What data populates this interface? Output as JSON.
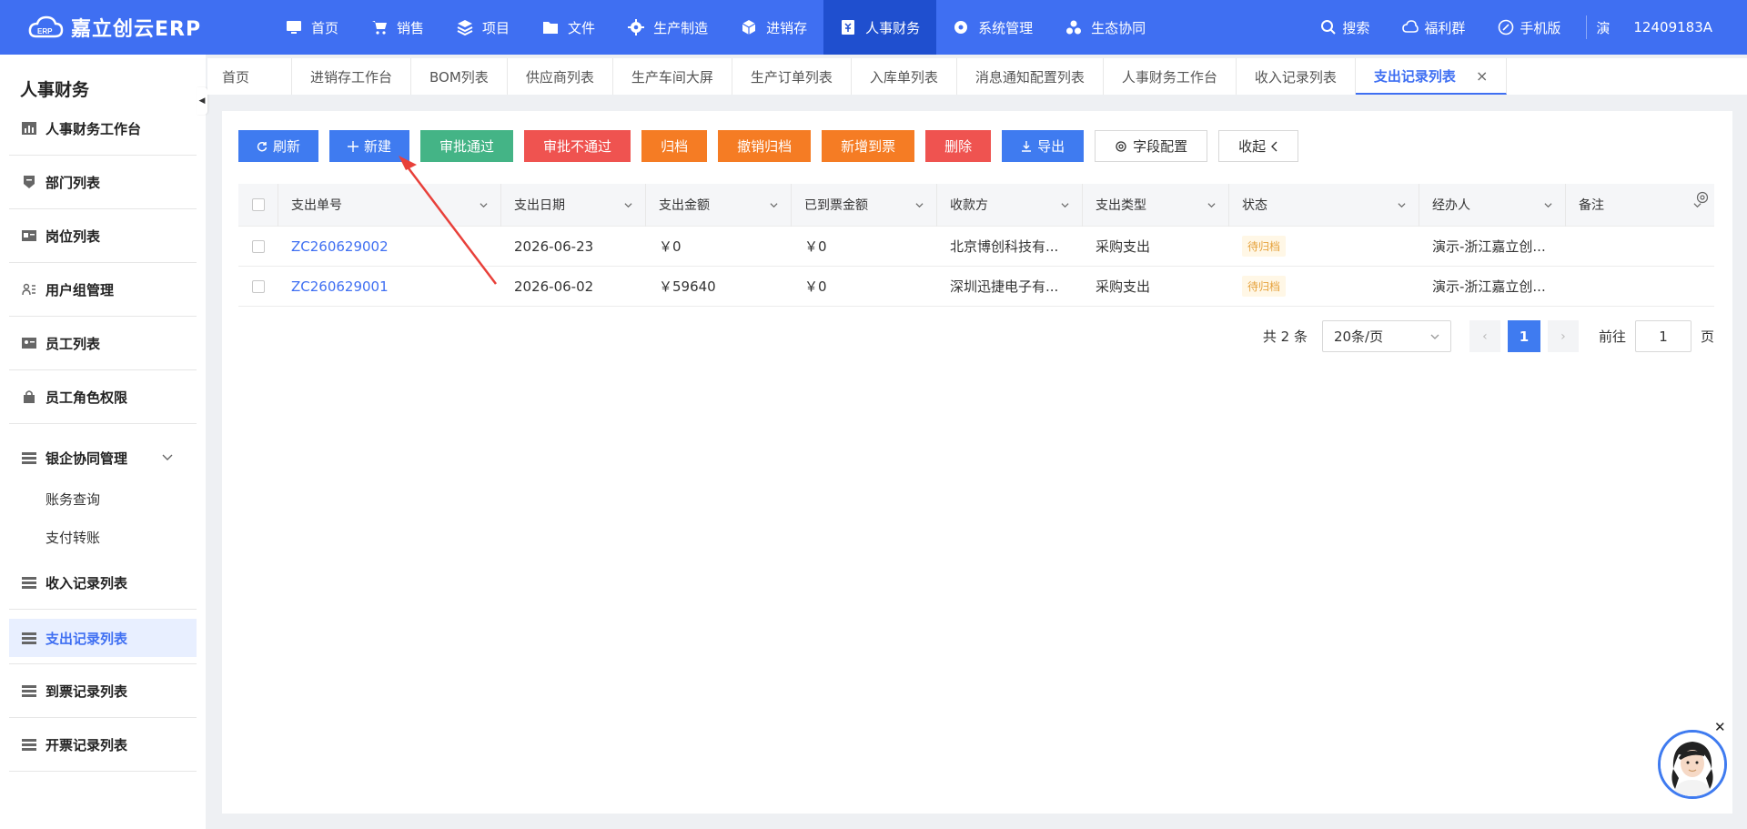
{
  "app": {
    "logo_text": "嘉立创云ERP",
    "accent": "#3f6ff2"
  },
  "nav": {
    "items": [
      {
        "label": "首页",
        "icon": "monitor-icon"
      },
      {
        "label": "销售",
        "icon": "cart-icon"
      },
      {
        "label": "项目",
        "icon": "layers-icon"
      },
      {
        "label": "文件",
        "icon": "folder-icon"
      },
      {
        "label": "生产制造",
        "icon": "gear-icon"
      },
      {
        "label": "进销存",
        "icon": "box-icon"
      },
      {
        "label": "人事财务",
        "icon": "finance-icon"
      },
      {
        "label": "系统管理",
        "icon": "settings-icon"
      },
      {
        "label": "生态协同",
        "icon": "cluster-icon"
      }
    ],
    "active": "人事财务"
  },
  "tools": {
    "search": "搜索",
    "welfare": "福利群",
    "mobile": "手机版",
    "user_short": "演",
    "user_id": "12409183A"
  },
  "sidebar": {
    "title": "人事财务",
    "items": [
      {
        "label": "人事财务工作台",
        "icon": "chart-icon"
      },
      {
        "label": "部门列表",
        "icon": "shield-icon"
      },
      {
        "label": "岗位列表",
        "icon": "idcard-icon"
      },
      {
        "label": "用户组管理",
        "icon": "usergroup-icon"
      },
      {
        "label": "员工列表",
        "icon": "employee-icon"
      },
      {
        "label": "员工角色权限",
        "icon": "lock-icon"
      },
      {
        "label": "银企协同管理",
        "icon": "bank-icon"
      },
      {
        "label": "收入记录列表",
        "icon": "list-icon"
      },
      {
        "label": "支出记录列表",
        "icon": "list-icon"
      },
      {
        "label": "到票记录列表",
        "icon": "list-icon"
      },
      {
        "label": "开票记录列表",
        "icon": "list-icon"
      }
    ],
    "sub_items": [
      "账务查询",
      "支付转账"
    ],
    "active": "支出记录列表"
  },
  "tabs": {
    "items": [
      "首页",
      "进销存工作台",
      "BOM列表",
      "供应商列表",
      "生产车间大屏",
      "生产订单列表",
      "入库单列表",
      "消息通知配置列表",
      "人事财务工作台",
      "收入记录列表",
      "支出记录列表"
    ],
    "active": "支出记录列表",
    "close_glyph": "×"
  },
  "toolbar": {
    "refresh": "刷新",
    "new": "新建",
    "approve": "审批通过",
    "reject": "审批不通过",
    "archive": "归档",
    "unarchive": "撤销归档",
    "add_invoice": "新增到票",
    "delete": "删除",
    "export": "导出",
    "field_config": "字段配置",
    "collapse": "收起"
  },
  "table": {
    "columns": [
      "支出单号",
      "支出日期",
      "支出金额",
      "已到票金额",
      "收款方",
      "支出类型",
      "状态",
      "经办人",
      "备注"
    ],
    "rows": [
      {
        "no": "ZC260629002",
        "date": "2026-06-23",
        "amount": "￥0",
        "invoiced": "￥0",
        "payee": "北京博创科技有...",
        "type": "采购支出",
        "status": "待归档",
        "handler": "演示-浙江嘉立创...",
        "remark": ""
      },
      {
        "no": "ZC260629001",
        "date": "2026-06-02",
        "amount": "￥59640",
        "invoiced": "￥0",
        "payee": "深圳迅捷电子有...",
        "type": "采购支出",
        "status": "待归档",
        "handler": "演示-浙江嘉立创...",
        "remark": ""
      }
    ]
  },
  "pagination": {
    "total": "共 2 条",
    "page_size": "20条/页",
    "current": "1",
    "goto_label": "前往",
    "goto_value": "1",
    "page_unit": "页"
  }
}
